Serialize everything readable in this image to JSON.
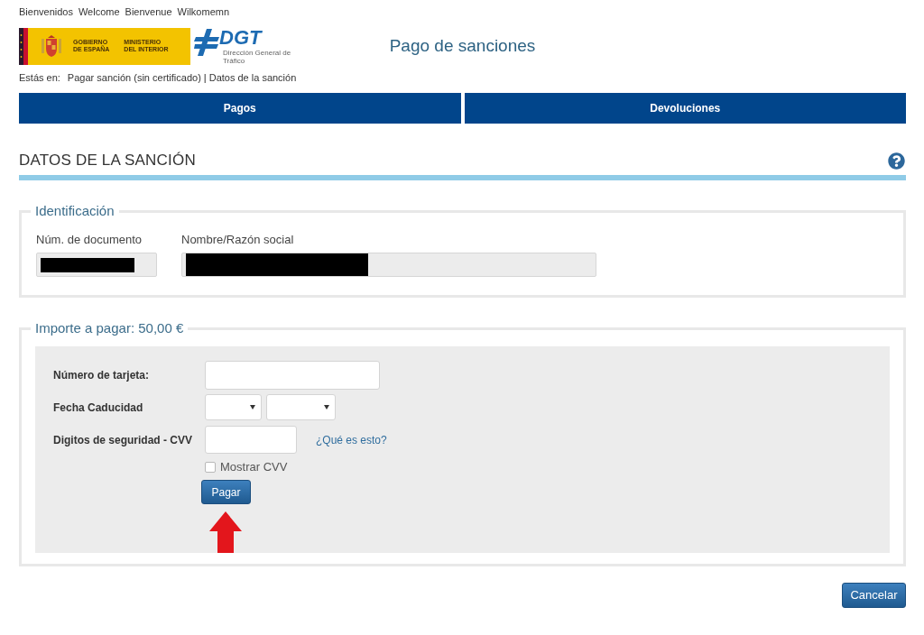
{
  "language_links": [
    "Bienvenidos",
    "Welcome",
    "Bienvenue",
    "Wilkomemn"
  ],
  "header": {
    "government_logo": {
      "left_lines": [
        "GOBIERNO",
        "DE ESPAÑA"
      ],
      "right_lines": [
        "MINISTERIO",
        "DEL INTERIOR"
      ]
    },
    "agency_logo": {
      "wordmark": "DGT",
      "caption": "Dirección General de Tráfico"
    },
    "title": "Pago de sanciones"
  },
  "breadcrumb": {
    "label": "Estás en:",
    "items": [
      "Pagar sanción (sin certificado)",
      "Datos de la sanción"
    ],
    "separator": "|"
  },
  "nav_buttons": [
    "Pagos",
    "Devoluciones"
  ],
  "section_title": "DATOS DE LA SANCIÓN",
  "identification": {
    "legend": "Identificación",
    "fields": [
      {
        "label": "Núm. de documento",
        "redacted": true
      },
      {
        "label": "Nombre/Razón social",
        "redacted": true
      }
    ]
  },
  "payment": {
    "legend": "Importe a pagar: 50,00 €",
    "rows": [
      {
        "kind": "text_input",
        "label": "Número de tarjeta:"
      },
      {
        "kind": "date_selects",
        "label": "Fecha Caducidad"
      },
      {
        "kind": "code_input",
        "label": "Digitos de seguridad - CVV",
        "link": "¿Qué es esto?"
      }
    ],
    "show_cvv": {
      "label": "Mostrar CVV",
      "checked": false
    },
    "submit_button": "Pagar"
  },
  "cancel_button": "Cancelar"
}
